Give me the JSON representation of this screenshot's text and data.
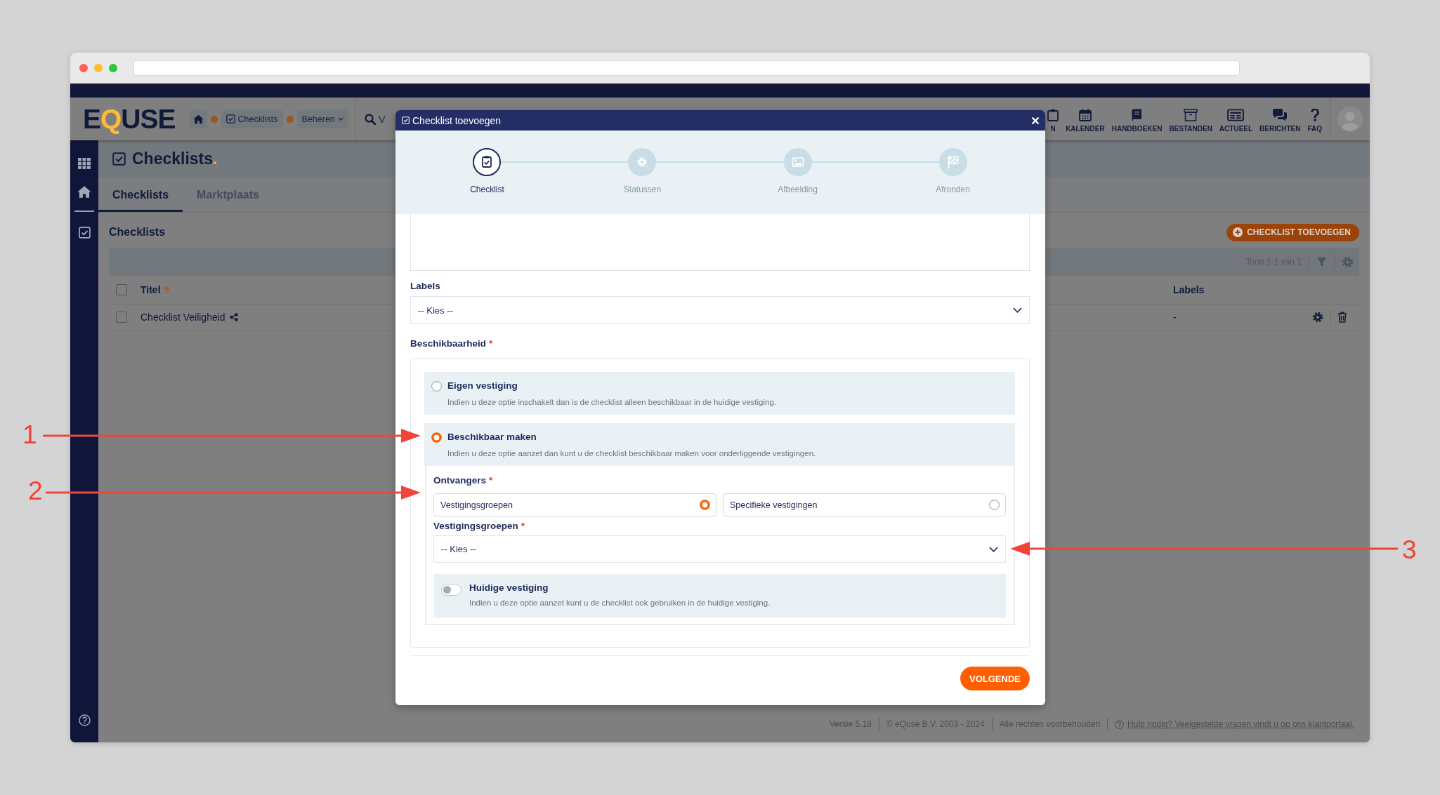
{
  "header": {
    "logo": "E**Q**USE",
    "breadcrumb": [
      {
        "kind": "home"
      },
      {
        "kind": "link",
        "label": "Checklists"
      },
      {
        "kind": "menu",
        "label": "Beheren"
      }
    ],
    "search_text": "V",
    "nav": [
      {
        "label": "N"
      },
      {
        "label": "KALENDER"
      },
      {
        "label": "HANDBOEKEN"
      },
      {
        "label": "BESTANDEN"
      },
      {
        "label": "ACTUEEL"
      },
      {
        "label": "BERICHTEN"
      },
      {
        "label": "FAQ"
      }
    ]
  },
  "page": {
    "title": "Checklists**.**",
    "tabs": [
      {
        "label": "Checklists",
        "selected": true
      },
      {
        "label": "Marktplaats",
        "selected": false
      }
    ],
    "section_title": "Checklists",
    "add_button": "CHECKLIST TOEVOEGEN",
    "table": {
      "pager": "Toon 1-1 van 1",
      "select_all": {
        "checked": false
      },
      "columns": [
        {
          "label": "Titel",
          "sorted": true
        },
        {
          "label": "Labels"
        }
      ],
      "rows": [
        {
          "checked": false,
          "shared": true,
          "cells": [
            "Checklist Veiligheid",
            "-"
          ]
        }
      ]
    }
  },
  "footer": {
    "items": [
      "Versie 5.18",
      "© eQuse B.V. 2003 - 2024",
      "Alle rechten voorbehouden"
    ],
    "help_link": "Hulp nodig? Veelgestelde vragen vindt u op ons klantportaal."
  },
  "modal": {
    "title": "Checklist toevoegen",
    "steps": [
      {
        "label": "Checklist",
        "selected": true
      },
      {
        "label": "Statussen",
        "selected": false
      },
      {
        "label": "Afbeelding",
        "selected": false
      },
      {
        "label": "Afronden",
        "selected": false
      }
    ],
    "labels_field": {
      "label": "Labels",
      "value": "-- Kies --"
    },
    "availability": {
      "label": "Beschikbaarheid",
      "required_mark": "*",
      "options": [
        {
          "title": "Eigen vestiging",
          "description": "Indien u deze optie inschakelt dan is de checklist alleen beschikbaar in de huidige vestiging.",
          "selected": false
        },
        {
          "title": "Beschikbaar maken",
          "description": "Indien u deze optie aanzet dan kunt u de checklist beschikbaar maken voor onderliggende vestigingen.",
          "selected": true,
          "details": {
            "recipients": {
              "label": "Ontvangers",
              "required_mark": "*",
              "choices": [
                {
                  "label": "Vestigingsgroepen",
                  "selected": true
                },
                {
                  "label": "Specifieke vestigingen",
                  "selected": false
                }
              ]
            },
            "groups_field": {
              "label": "Vestigingsgroepen",
              "required_mark": "*",
              "value": "-- Kies --"
            },
            "current_branch": {
              "title": "Huidige vestiging",
              "description": "Indien u deze optie aanzet kunt u de checklist ook gebruiken in de huidige vestiging.",
              "on": false
            }
          }
        }
      ]
    },
    "next_button": "VOLGENDE"
  },
  "annotations": [
    {
      "label": "1"
    },
    {
      "label": "2"
    },
    {
      "label": "3"
    }
  ]
}
